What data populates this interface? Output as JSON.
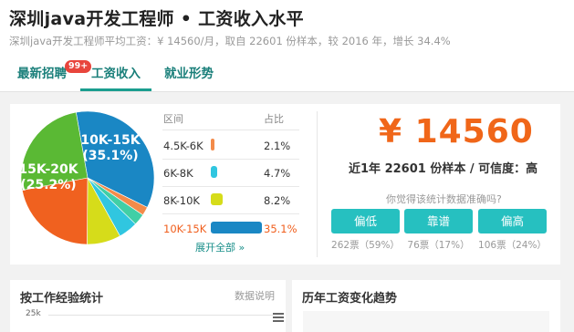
{
  "header": {
    "title": "深圳java开发工程师 • 工资收入水平",
    "subtitle": "深圳java开发工程师平均工资：¥ 14560/月，取自 22601 份样本，较 2016 年，增长 34.4%"
  },
  "tabs": [
    {
      "label": "最新招聘",
      "badge": "99+"
    },
    {
      "label": "工资收入"
    },
    {
      "label": "就业形势"
    }
  ],
  "legend": {
    "col_range": "区间",
    "col_pct": "占比",
    "rows": [
      {
        "range": "4.5K-6K",
        "pct": "2.1%",
        "value": 2.1,
        "color": "#f38b4a"
      },
      {
        "range": "6K-8K",
        "pct": "4.7%",
        "value": 4.7,
        "color": "#30c6e0"
      },
      {
        "range": "8K-10K",
        "pct": "8.2%",
        "value": 8.2,
        "color": "#d6dc1a"
      },
      {
        "range": "10K-15K",
        "pct": "35.1%",
        "value": 35.1,
        "color": "#1a87c4"
      }
    ],
    "more": "展开全部 »"
  },
  "pie": {
    "slices": [
      {
        "value": 35.1,
        "color": "#1a87c4"
      },
      {
        "value": 2.1,
        "color": "#f38b4a"
      },
      {
        "value": 2.8,
        "color": "#41cfa6"
      },
      {
        "value": 4.7,
        "color": "#30c6e0"
      },
      {
        "value": 8.2,
        "color": "#d6dc1a"
      },
      {
        "value": 21.9,
        "color": "#f0611f"
      },
      {
        "value": 25.2,
        "color": "#5ab934"
      }
    ],
    "labels": [
      {
        "line1": "10K-15K",
        "line2": "(35.1%)"
      },
      {
        "line1": "15K-20K",
        "line2": "(25.2%)"
      }
    ]
  },
  "summary": {
    "salary": "¥ 14560",
    "sample": "近1年 22601 份样本 / 可信度：高",
    "ask": "你觉得该统计数据准确吗?",
    "votes": [
      {
        "label": "偏低",
        "count": "262票（59%）"
      },
      {
        "label": "靠谱",
        "count": "76票（17%）"
      },
      {
        "label": "偏高",
        "count": "106票（24%）"
      }
    ]
  },
  "experience": {
    "title": "按工作经验统计",
    "note": "数据说明",
    "ytick": "25k"
  },
  "trend": {
    "title": "历年工资变化趋势"
  }
}
